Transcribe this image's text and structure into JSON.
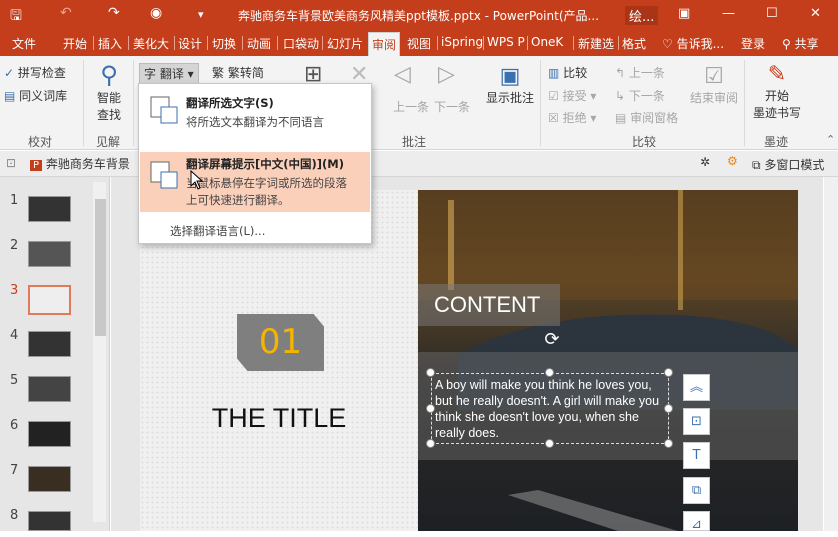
{
  "window": {
    "title": "奔驰商务车背景欧美商务风精美ppt模板.pptx - PowerPoint(产品...",
    "context_tab": "绘...",
    "controls": [
      "▣",
      "—",
      "☐",
      "✕"
    ]
  },
  "ribbon_tabs": [
    "文件",
    "开始",
    "插入",
    "美化大",
    "设计",
    "切换",
    "动画",
    "口袋动",
    "幻灯片",
    "审阅",
    "视图",
    "iSpring",
    "WPS P",
    "OneK",
    "新建选",
    "格式"
  ],
  "tab_right": {
    "tell_me": "告诉我...",
    "login": "登录",
    "share": "共享"
  },
  "ribbon": {
    "spell_check": "拼写检查",
    "thesaurus": "同义词库",
    "smart_lookup": [
      "智能",
      "查找"
    ],
    "translate": "翻译",
    "trad_simp": "繁转简",
    "prev": "上一条",
    "next": "下一条",
    "show_comments": "显示批注",
    "compare": "比较",
    "accept": "接受",
    "reject": "拒绝",
    "prev2": "上一条",
    "next2": "下一条",
    "review_pane": "审阅窗格",
    "end_review": "结束审阅",
    "start_ink": [
      "开始",
      "墨迹书写"
    ],
    "groups": {
      "proofing": "校对",
      "insights": "见解",
      "comments": "批注",
      "compare": "比较",
      "ink": "墨迹"
    }
  },
  "doc_tab": {
    "name": "奔驰商务车背景",
    "multi_window": "多窗口模式"
  },
  "thumbnails": [
    1,
    2,
    3,
    4,
    5,
    6,
    7,
    8
  ],
  "selected_slide": 3,
  "slide": {
    "number_badge": "01",
    "title": "THE TITLE",
    "content_label": "CONTENT",
    "body_text": "A boy will make you think he loves you, but he really doesn't. A girl will make you think she doesn't love you, when she really does."
  },
  "translate_menu": {
    "item1_title": "翻译所选文字(S)",
    "item1_desc": "将所选文本翻译为不同语言",
    "item2_title": "翻译屏幕提示[中文(中国)](M)",
    "item2_desc1": "当鼠标悬停在字词或所选的段落",
    "item2_desc2": "上可快速进行翻译。",
    "choose_lang": "选择翻译语言(L)..."
  },
  "colors": {
    "accent": "#c43e1c",
    "highlight": "#fbd0bb",
    "badge_text": "#f5b400"
  }
}
